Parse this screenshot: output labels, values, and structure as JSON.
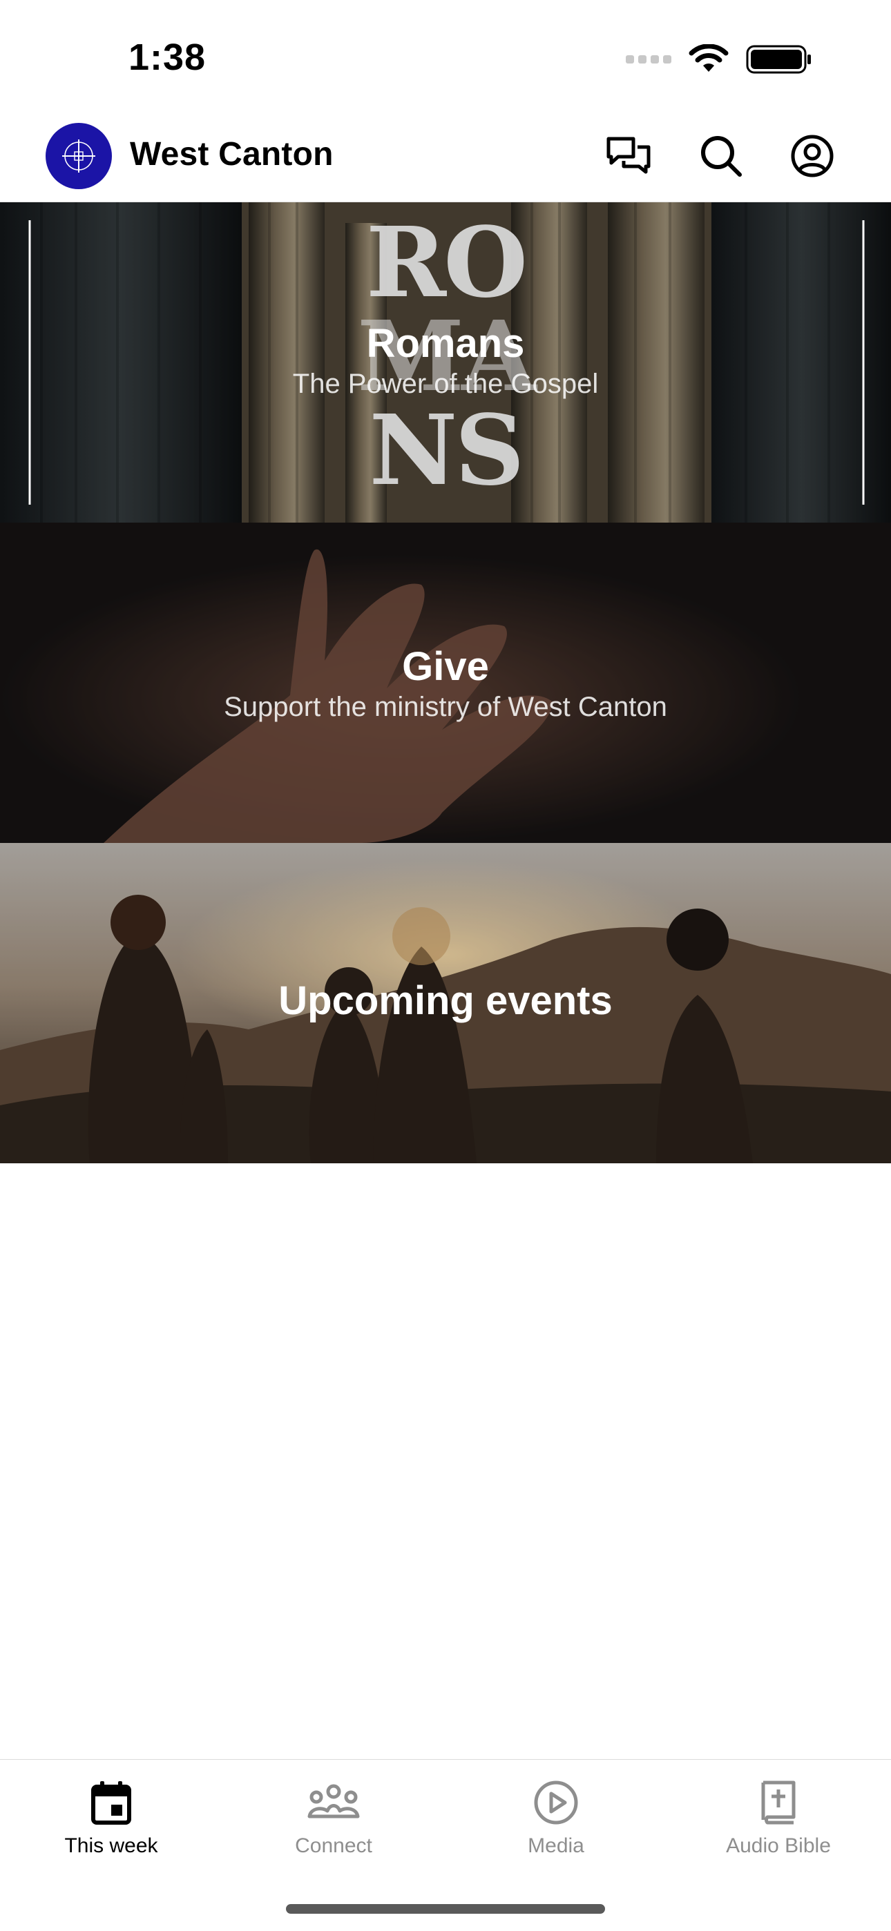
{
  "status_bar": {
    "time": "1:38"
  },
  "header": {
    "title": "West Canton"
  },
  "cards": [
    {
      "title": "Romans",
      "subtitle": "The Power of the Gospel",
      "art_text": [
        "RO",
        "MA",
        "NS"
      ]
    },
    {
      "title": "Give",
      "subtitle": "Support the ministry of West Canton"
    },
    {
      "title": "Upcoming events"
    }
  ],
  "tabbar": {
    "items": [
      {
        "label": "This week",
        "icon": "calendar-icon",
        "active": true
      },
      {
        "label": "Connect",
        "icon": "people-group-icon",
        "active": false
      },
      {
        "label": "Media",
        "icon": "play-circle-icon",
        "active": false
      },
      {
        "label": "Audio Bible",
        "icon": "bible-book-icon",
        "active": false
      }
    ]
  },
  "colors": {
    "brand": "#1b14a6",
    "tab_active": "#000000",
    "tab_inactive": "#8e8e8e"
  }
}
